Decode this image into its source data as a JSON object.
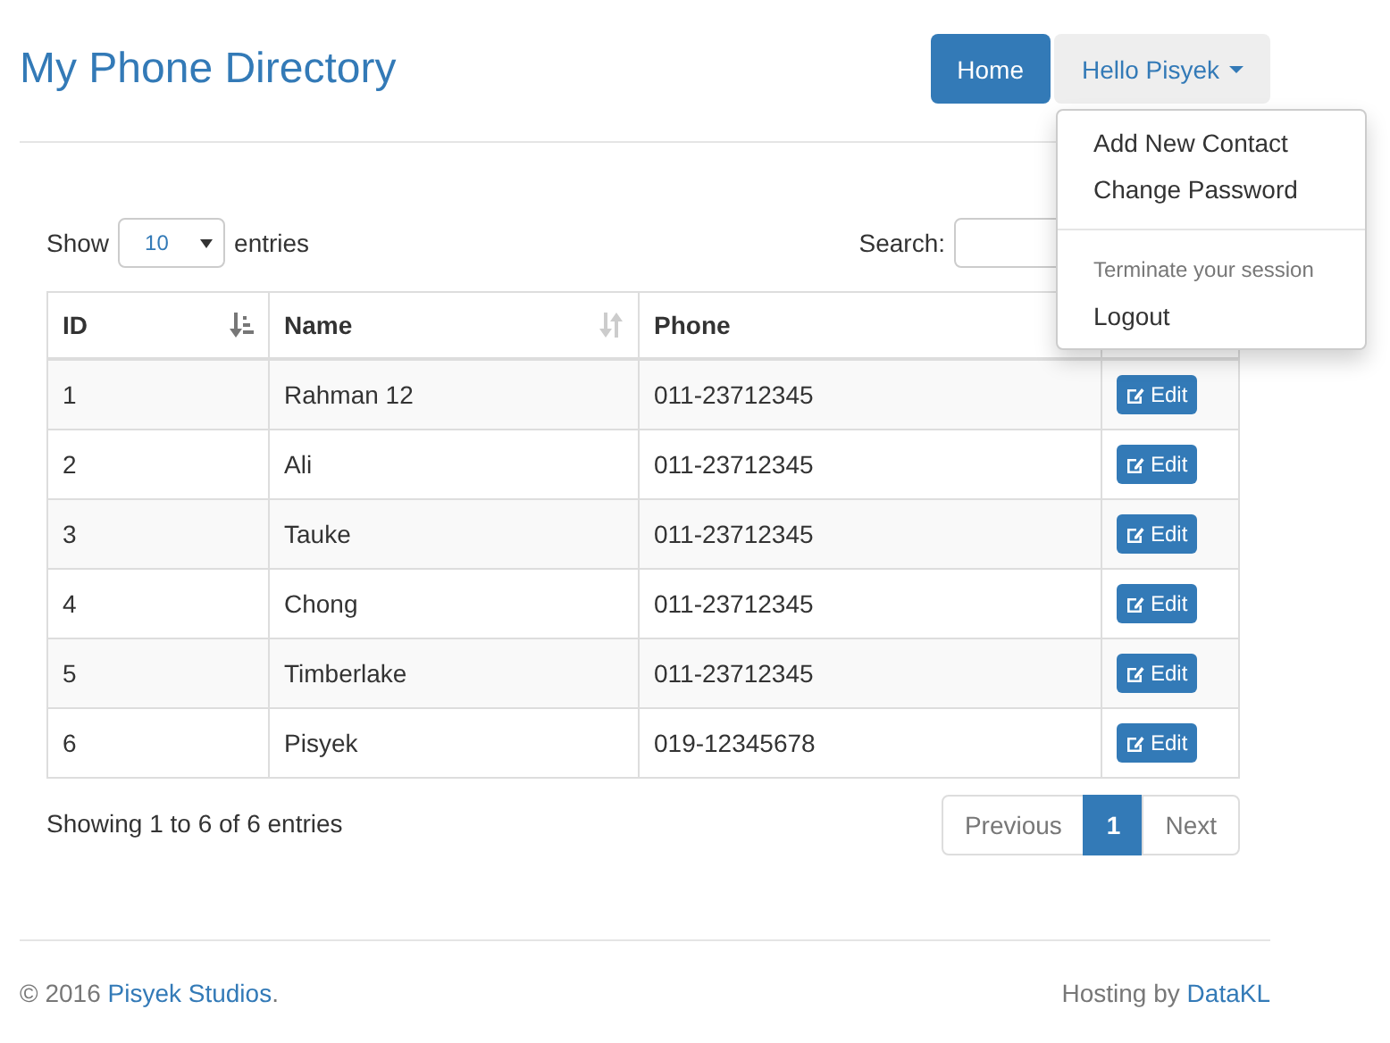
{
  "title": "My Phone Directory",
  "nav": {
    "home": "Home",
    "user_menu": {
      "label": "Hello Pisyek",
      "open": true,
      "items": [
        {
          "kind": "item",
          "label": "Add New Contact"
        },
        {
          "kind": "item",
          "label": "Change Password"
        },
        {
          "kind": "divider"
        },
        {
          "kind": "header",
          "label": "Terminate your session"
        },
        {
          "kind": "item",
          "label": "Logout"
        }
      ]
    }
  },
  "table_controls": {
    "show_label": "Show",
    "length_value": "10",
    "entries_label": "entries",
    "search_label": "Search:"
  },
  "table": {
    "columns": [
      {
        "label": "ID",
        "sorted": true
      },
      {
        "label": "Name",
        "sorted": false
      },
      {
        "label": "Phone"
      }
    ],
    "rows": [
      {
        "id": "1",
        "name": "Rahman 12",
        "phone": "011-23712345",
        "action": "Edit"
      },
      {
        "id": "2",
        "name": "Ali",
        "phone": "011-23712345",
        "action": "Edit"
      },
      {
        "id": "3",
        "name": "Tauke",
        "phone": "011-23712345",
        "action": "Edit"
      },
      {
        "id": "4",
        "name": "Chong",
        "phone": "011-23712345",
        "action": "Edit"
      },
      {
        "id": "5",
        "name": "Timberlake",
        "phone": "011-23712345",
        "action": "Edit"
      },
      {
        "id": "6",
        "name": "Pisyek",
        "phone": "019-12345678",
        "action": "Edit"
      }
    ]
  },
  "info": "Showing 1 to 6 of 6 entries",
  "pagination": [
    {
      "label": "Previous",
      "disabled": true,
      "selected": false
    },
    {
      "label": "1",
      "disabled": false,
      "selected": true
    },
    {
      "label": "Next",
      "disabled": true,
      "selected": false
    }
  ],
  "footer": {
    "copyright": "© 2016 ",
    "owner_link": "Pisyek Studios",
    "copyright_end": ".",
    "hosting": "Hosting by ",
    "host_link": "DataKL"
  }
}
